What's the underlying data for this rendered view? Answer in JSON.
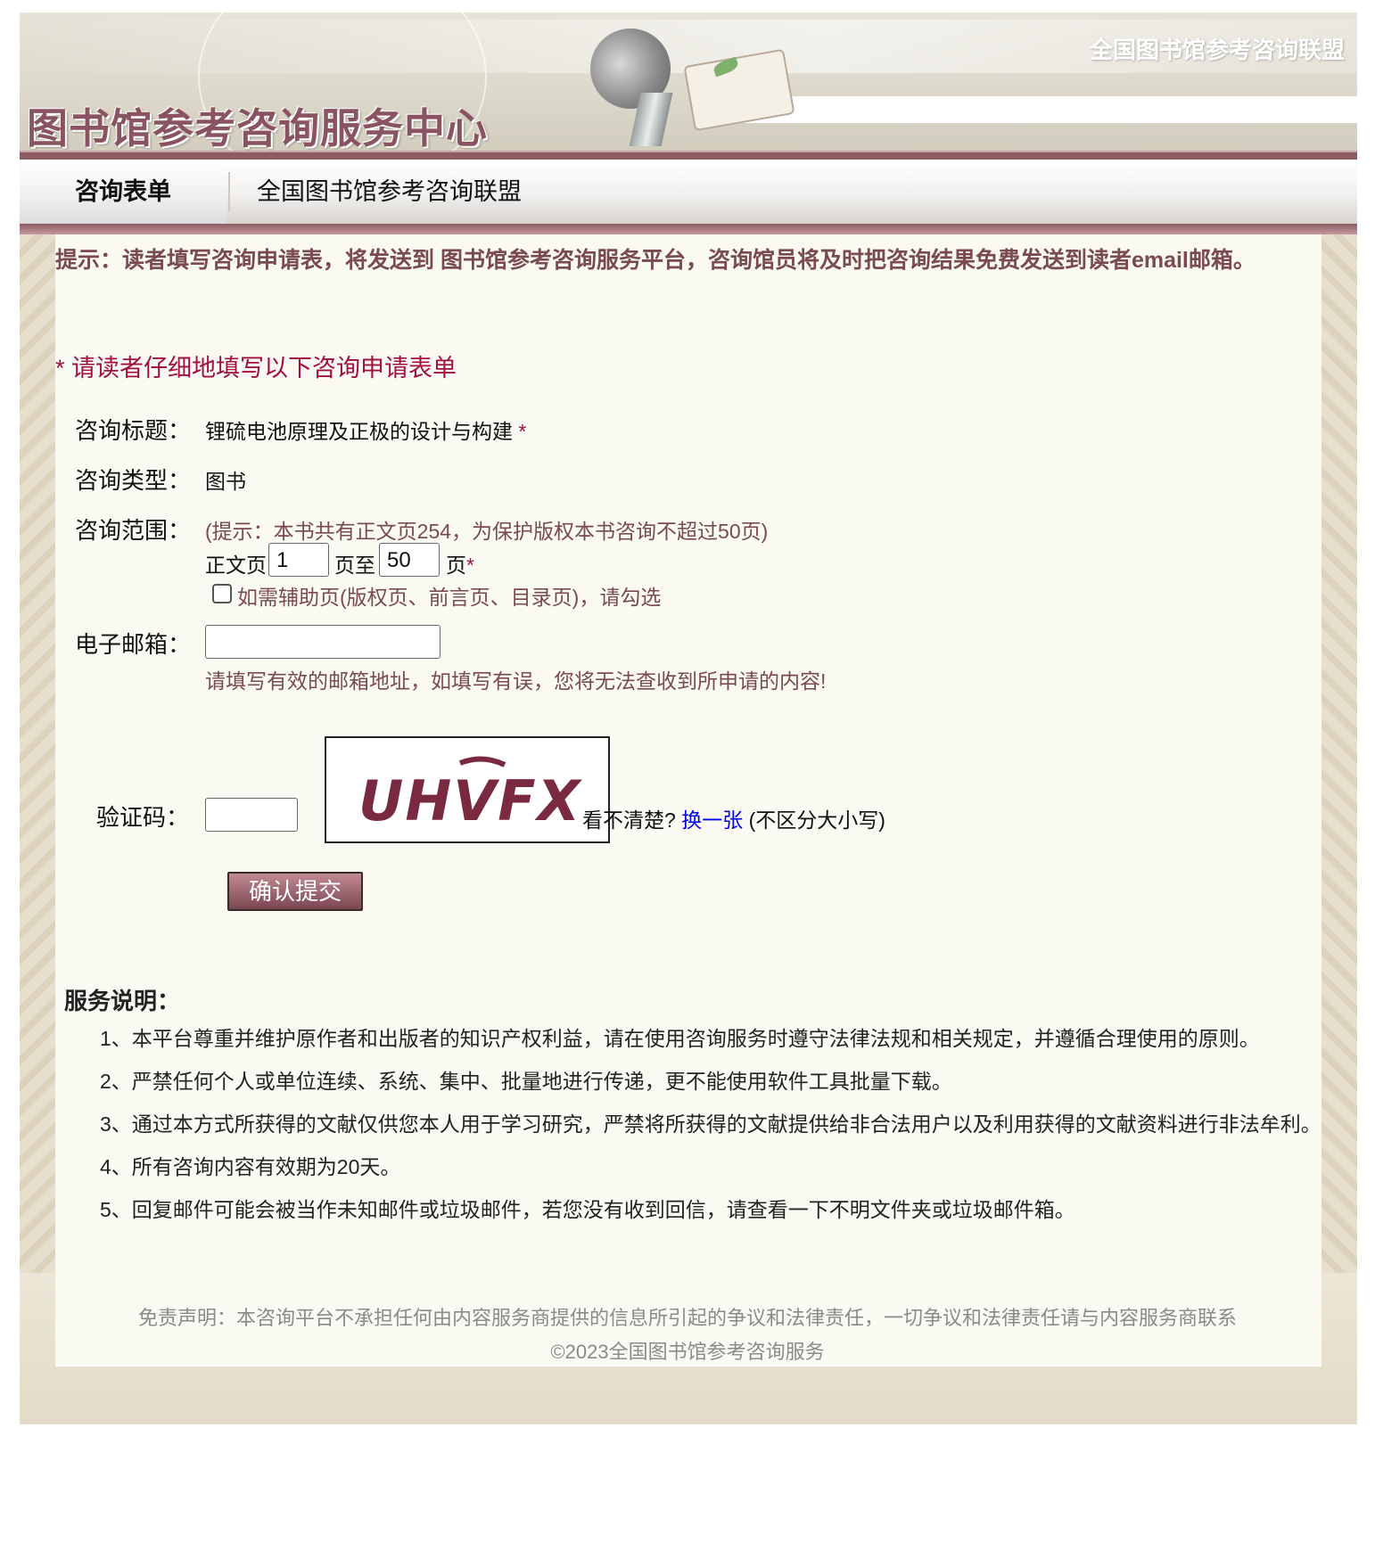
{
  "header": {
    "logo_text": "图书馆参考咨询服务中心",
    "alliance_text": "全国图书馆参考咨询联盟"
  },
  "tabs": [
    {
      "label": "咨询表单",
      "active": true
    },
    {
      "label": "全国图书馆参考咨询联盟",
      "active": false
    }
  ],
  "notice": "提示：读者填写咨询申请表，将发送到 图书馆参考咨询服务平台，咨询馆员将及时把咨询结果免费发送到读者email邮箱。",
  "form_title_star": "*",
  "form_title": "请读者仔细地填写以下咨询申请表单",
  "form": {
    "title_label": "咨询标题：",
    "title_value": "锂硫电池原理及正极的设计与构建",
    "required_mark": "*",
    "type_label": "咨询类型：",
    "type_value": "图书",
    "scope_label": "咨询范围：",
    "scope_hint": "(提示：本书共有正文页254，为保护版权本书咨询不超过50页)",
    "page_prefix": "正文页",
    "page_from": "1",
    "page_mid": "页至",
    "page_to": "50",
    "page_suffix": "页",
    "aux_pages_label": "如需辅助页(版权页、前言页、目录页)，请勾选",
    "aux_pages_checked": false,
    "email_label": "电子邮箱：",
    "email_value": "",
    "email_hint": "请填写有效的邮箱地址，如填写有误，您将无法查收到所申请的内容!",
    "captcha_label": "验证码：",
    "captcha_value": "",
    "captcha_image_text": "UHVFX",
    "captcha_unclear": "看不清楚?",
    "captcha_refresh": "换一张",
    "captcha_note": "(不区分大小写)",
    "submit_label": "确认提交"
  },
  "service": {
    "title": "服务说明：",
    "items": [
      "1、本平台尊重并维护原作者和出版者的知识产权利益，请在使用咨询服务时遵守法律法规和相关规定，并遵循合理使用的原则。",
      "2、严禁任何个人或单位连续、系统、集中、批量地进行传递，更不能使用软件工具批量下载。",
      "3、通过本方式所获得的文献仅供您本人用于学习研究，严禁将所获得的文献提供给非合法用户以及利用获得的文献资料进行非法牟利。",
      "4、所有咨询内容有效期为20天。",
      "5、回复邮件可能会被当作未知邮件或垃圾邮件，若您没有收到回信，请查看一下不明文件夹或垃圾邮件箱。"
    ]
  },
  "footer": {
    "disclaimer": "免责声明：本咨询平台不承担任何由内容服务商提供的信息所引起的争议和法律责任，一切争议和法律责任请与内容服务商联系",
    "copyright": "©2023全国图书馆参考咨询服务"
  },
  "colors": {
    "brand_maroon": "#8e5a62",
    "notice_text": "#7a4a52",
    "required_red": "#a01040",
    "link_blue": "#0000ee"
  }
}
